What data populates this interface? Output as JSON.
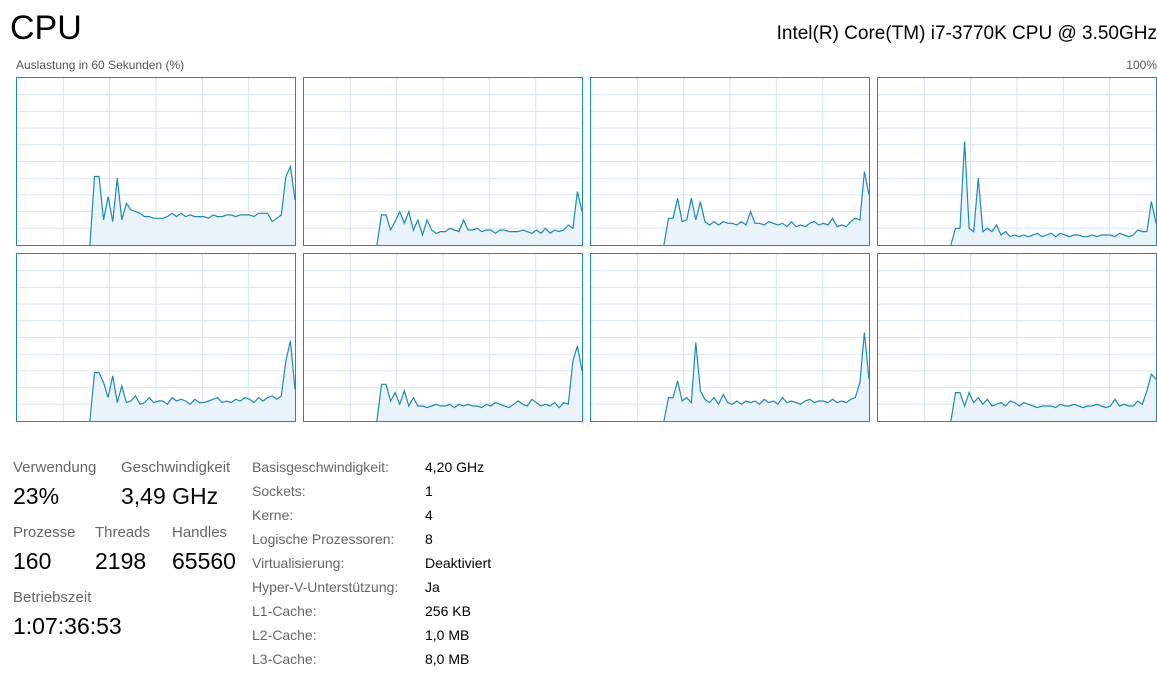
{
  "header": {
    "title": "CPU",
    "cpu_name": "Intel(R) Core(TM) i7-3770K CPU @ 3.50GHz",
    "graph_caption": "Auslastung in 60 Sekunden (%)",
    "graph_max": "100%"
  },
  "colors": {
    "graph_border": "#1a8bb8",
    "graph_line": "#1a8bb8",
    "graph_fill": "#eaf3fa",
    "grid": "#d6e6f0"
  },
  "chart_data": {
    "type": "area",
    "ylim": [
      0,
      100
    ],
    "x_seconds": 60,
    "series": [
      {
        "values": [
          0,
          0,
          0,
          0,
          0,
          0,
          0,
          0,
          0,
          0,
          0,
          0,
          0,
          0,
          0,
          0,
          0,
          41,
          41,
          15,
          29,
          14,
          40,
          15,
          25,
          21,
          20,
          19,
          17,
          17,
          16,
          16,
          16,
          17,
          19,
          17,
          19,
          17,
          18,
          17,
          17,
          17,
          16,
          18,
          17,
          17,
          18,
          18,
          17,
          18,
          18,
          18,
          17,
          19,
          19,
          19,
          14,
          16,
          18,
          41,
          47,
          27
        ]
      },
      {
        "values": [
          0,
          0,
          0,
          0,
          0,
          0,
          0,
          0,
          0,
          0,
          0,
          0,
          0,
          0,
          0,
          0,
          0,
          18,
          18,
          9,
          14,
          20,
          13,
          20,
          9,
          15,
          6,
          15,
          9,
          7,
          8,
          8,
          10,
          9,
          8,
          15,
          9,
          9,
          10,
          8,
          9,
          9,
          7,
          9,
          9,
          8,
          8,
          8,
          9,
          8,
          7,
          9,
          7,
          10,
          7,
          9,
          8,
          9,
          12,
          10,
          32,
          20
        ]
      },
      {
        "values": [
          0,
          0,
          0,
          0,
          0,
          0,
          0,
          0,
          0,
          0,
          0,
          0,
          0,
          0,
          0,
          0,
          0,
          16,
          16,
          28,
          14,
          15,
          28,
          15,
          26,
          14,
          12,
          14,
          12,
          14,
          13,
          13,
          12,
          14,
          12,
          20,
          13,
          13,
          12,
          14,
          13,
          12,
          13,
          11,
          14,
          11,
          12,
          11,
          13,
          14,
          12,
          13,
          12,
          16,
          11,
          12,
          11,
          14,
          16,
          15,
          44,
          30
        ]
      },
      {
        "values": [
          0,
          0,
          0,
          0,
          0,
          0,
          0,
          0,
          0,
          0,
          0,
          0,
          0,
          0,
          0,
          0,
          0,
          10,
          10,
          62,
          10,
          8,
          40,
          8,
          10,
          8,
          12,
          6,
          8,
          5,
          6,
          5,
          6,
          5,
          6,
          7,
          5,
          6,
          7,
          5,
          7,
          6,
          5,
          6,
          6,
          5,
          5,
          6,
          5,
          6,
          6,
          6,
          5,
          7,
          6,
          5,
          6,
          9,
          8,
          8,
          26,
          13
        ]
      },
      {
        "values": [
          0,
          0,
          0,
          0,
          0,
          0,
          0,
          0,
          0,
          0,
          0,
          0,
          0,
          0,
          0,
          0,
          0,
          29,
          29,
          23,
          14,
          27,
          11,
          21,
          11,
          12,
          15,
          10,
          11,
          14,
          11,
          12,
          12,
          10,
          14,
          12,
          13,
          12,
          10,
          13,
          11,
          11,
          12,
          13,
          14,
          11,
          12,
          11,
          13,
          12,
          14,
          13,
          11,
          14,
          12,
          14,
          15,
          13,
          15,
          36,
          48,
          19
        ]
      },
      {
        "values": [
          0,
          0,
          0,
          0,
          0,
          0,
          0,
          0,
          0,
          0,
          0,
          0,
          0,
          0,
          0,
          0,
          0,
          22,
          22,
          12,
          17,
          10,
          18,
          9,
          14,
          9,
          9,
          8,
          9,
          10,
          9,
          9,
          10,
          8,
          10,
          9,
          10,
          9,
          9,
          8,
          10,
          9,
          11,
          10,
          9,
          8,
          10,
          12,
          10,
          9,
          13,
          11,
          9,
          10,
          9,
          11,
          8,
          11,
          10,
          36,
          45,
          30
        ]
      },
      {
        "values": [
          0,
          0,
          0,
          0,
          0,
          0,
          0,
          0,
          0,
          0,
          0,
          0,
          0,
          0,
          0,
          0,
          0,
          14,
          14,
          24,
          12,
          14,
          11,
          47,
          18,
          13,
          11,
          14,
          10,
          16,
          11,
          10,
          12,
          10,
          12,
          11,
          12,
          10,
          13,
          11,
          12,
          10,
          14,
          11,
          12,
          11,
          10,
          12,
          13,
          11,
          12,
          12,
          11,
          13,
          11,
          12,
          11,
          13,
          14,
          23,
          53,
          25
        ]
      },
      {
        "values": [
          0,
          0,
          0,
          0,
          0,
          0,
          0,
          0,
          0,
          0,
          0,
          0,
          0,
          0,
          0,
          0,
          0,
          17,
          17,
          9,
          17,
          11,
          14,
          10,
          13,
          9,
          10,
          11,
          9,
          12,
          11,
          9,
          11,
          10,
          9,
          8,
          9,
          9,
          9,
          8,
          10,
          9,
          9,
          10,
          9,
          8,
          9,
          9,
          10,
          9,
          8,
          9,
          13,
          9,
          10,
          9,
          9,
          12,
          10,
          18,
          28,
          25
        ]
      }
    ]
  },
  "stats": {
    "verwendung_label": "Verwendung",
    "verwendung_value": "23%",
    "geschwindigkeit_label": "Geschwindigkeit",
    "geschwindigkeit_value": "3,49 GHz",
    "prozesse_label": "Prozesse",
    "prozesse_value": "160",
    "threads_label": "Threads",
    "threads_value": "2198",
    "handles_label": "Handles",
    "handles_value": "65560",
    "betriebszeit_label": "Betriebszeit",
    "betriebszeit_value": "1:07:36:53"
  },
  "specs": [
    {
      "label": "Basisgeschwindigkeit:",
      "value": "4,20 GHz"
    },
    {
      "label": "Sockets:",
      "value": "1"
    },
    {
      "label": "Kerne:",
      "value": "4"
    },
    {
      "label": "Logische Prozessoren:",
      "value": "8"
    },
    {
      "label": "Virtualisierung:",
      "value": "Deaktiviert"
    },
    {
      "label": "Hyper-V-Unterstützung:",
      "value": "Ja"
    },
    {
      "label": "L1-Cache:",
      "value": "256 KB"
    },
    {
      "label": "L2-Cache:",
      "value": "1,0 MB"
    },
    {
      "label": "L3-Cache:",
      "value": "8,0 MB"
    }
  ]
}
